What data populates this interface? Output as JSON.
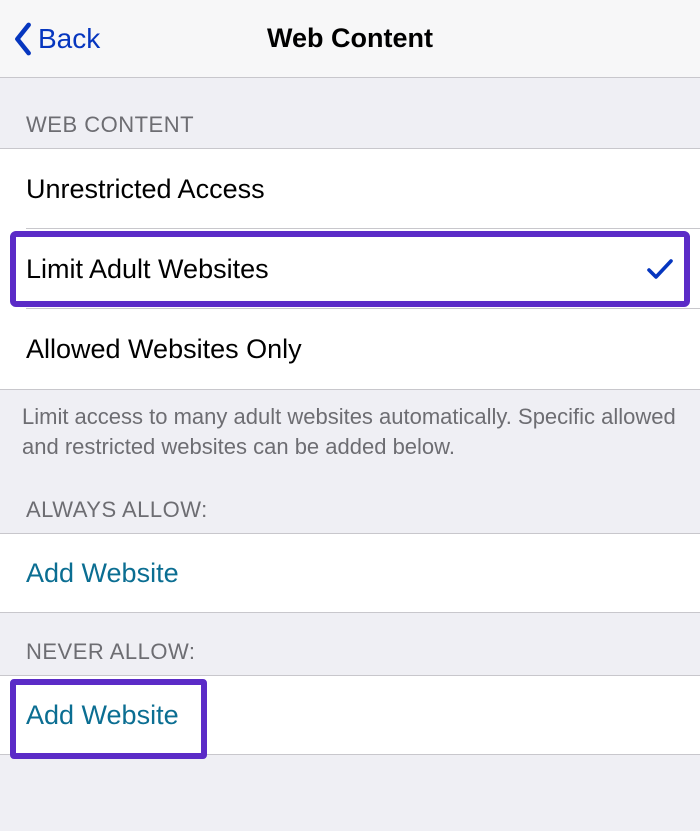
{
  "nav": {
    "back_label": "Back",
    "title": "Web Content"
  },
  "sections": {
    "main": {
      "header": "WEB CONTENT",
      "options": [
        {
          "label": "Unrestricted Access",
          "selected": false
        },
        {
          "label": "Limit Adult Websites",
          "selected": true
        },
        {
          "label": "Allowed Websites Only",
          "selected": false
        }
      ],
      "footer": "Limit access to many adult websites automatically. Specific allowed and restricted websites can be added below."
    },
    "always_allow": {
      "header": "ALWAYS ALLOW:",
      "add_label": "Add Website"
    },
    "never_allow": {
      "header": "NEVER ALLOW:",
      "add_label": "Add Website"
    }
  }
}
